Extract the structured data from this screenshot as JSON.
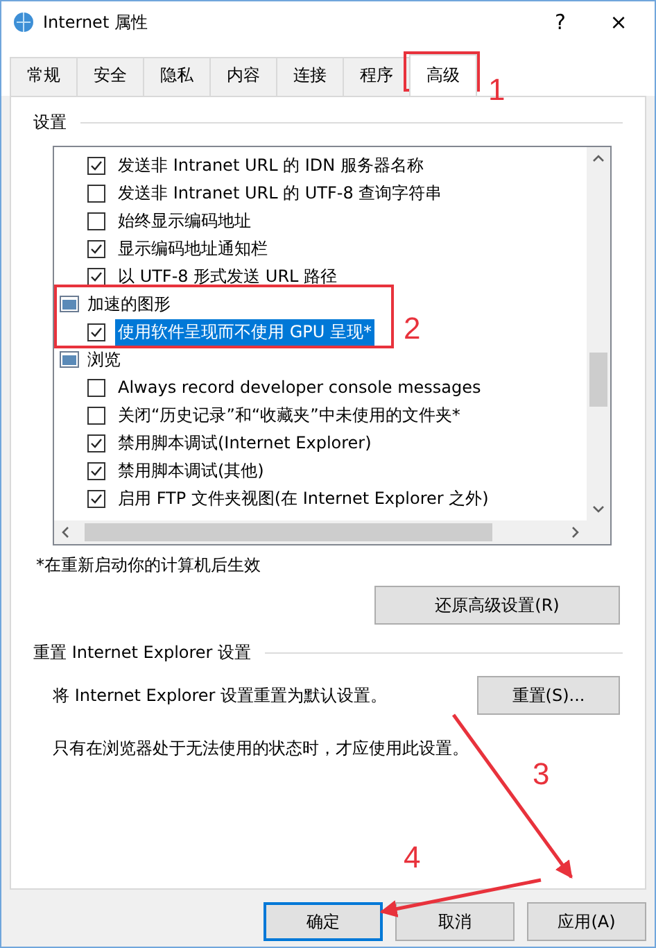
{
  "window": {
    "title": "Internet 属性",
    "help": "?",
    "close": "×"
  },
  "tabs": [
    {
      "label": "常规",
      "selected": false
    },
    {
      "label": "安全",
      "selected": false
    },
    {
      "label": "隐私",
      "selected": false
    },
    {
      "label": "内容",
      "selected": false
    },
    {
      "label": "连接",
      "selected": false
    },
    {
      "label": "程序",
      "selected": false
    },
    {
      "label": "高级",
      "selected": true
    }
  ],
  "settings": {
    "title": "设置",
    "tree": [
      {
        "kind": "checkbox",
        "label": "发送非 Intranet URL 的 IDN 服务器名称",
        "checked": true,
        "selected": false
      },
      {
        "kind": "checkbox",
        "label": "发送非 Intranet URL 的 UTF-8 查询字符串",
        "checked": false,
        "selected": false
      },
      {
        "kind": "checkbox",
        "label": "始终显示编码地址",
        "checked": false,
        "selected": false
      },
      {
        "kind": "checkbox",
        "label": "显示编码地址通知栏",
        "checked": true,
        "selected": false
      },
      {
        "kind": "checkbox",
        "label": "以 UTF-8 形式发送 URL 路径",
        "checked": true,
        "selected": false
      },
      {
        "kind": "category",
        "label": "加速的图形",
        "children": [
          {
            "kind": "checkbox",
            "label": "使用软件呈现而不使用 GPU 呈现*",
            "checked": true,
            "selected": true
          }
        ]
      },
      {
        "kind": "category",
        "label": "浏览",
        "children": [
          {
            "kind": "checkbox",
            "label": "Always record developer console messages",
            "checked": false,
            "selected": false
          },
          {
            "kind": "checkbox",
            "label": "关闭“历史记录”和“收藏夹”中未使用的文件夹*",
            "checked": false,
            "selected": false
          },
          {
            "kind": "checkbox",
            "label": "禁用脚本调试(Internet Explorer)",
            "checked": true,
            "selected": false
          },
          {
            "kind": "checkbox",
            "label": "禁用脚本调试(其他)",
            "checked": true,
            "selected": false
          },
          {
            "kind": "checkbox",
            "label": "启用 FTP 文件夹视图(在 Internet Explorer 之外)",
            "checked": true,
            "selected": false
          }
        ]
      }
    ],
    "note": "*在重新启动你的计算机后生效",
    "restore_button": "还原高级设置(R)"
  },
  "reset": {
    "title": "重置 Internet Explorer 设置",
    "description": "将 Internet Explorer 设置重置为默认设置。",
    "button": "重置(S)...",
    "warning": "只有在浏览器处于无法使用的状态时，才应使用此设置。"
  },
  "buttons": [
    {
      "label": "确定",
      "default": true
    },
    {
      "label": "取消",
      "default": false
    },
    {
      "label": "应用(A)",
      "default": false
    }
  ],
  "annotations": [
    {
      "label": "1"
    },
    {
      "label": "2"
    },
    {
      "label": "3"
    },
    {
      "label": "4"
    }
  ]
}
